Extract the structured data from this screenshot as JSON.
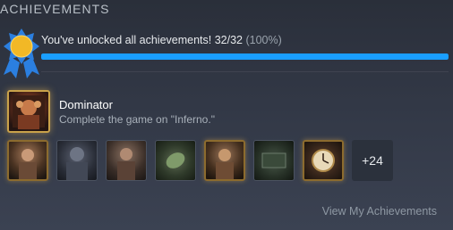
{
  "header": {
    "title": "ACHIEVEMENTS"
  },
  "summary": {
    "text": "You've unlocked all achievements! 32/32",
    "percent_text": "(100%)",
    "unlocked": 32,
    "total": 32,
    "progress_fraction": 1.0
  },
  "featured": {
    "title": "Dominator",
    "description": "Complete the game on \"Inferno.\""
  },
  "icons": [
    {
      "name": "achievement-icon-1",
      "style": "gold"
    },
    {
      "name": "achievement-icon-2",
      "style": "plain"
    },
    {
      "name": "achievement-icon-3",
      "style": "plain"
    },
    {
      "name": "achievement-icon-4",
      "style": "plain"
    },
    {
      "name": "achievement-icon-5",
      "style": "gold"
    },
    {
      "name": "achievement-icon-6",
      "style": "plain"
    },
    {
      "name": "achievement-icon-7",
      "style": "gold"
    }
  ],
  "more": {
    "label": "+24"
  },
  "footer": {
    "link_label": "View My Achievements"
  },
  "colors": {
    "accent": "#1a9fff",
    "gold": "#c9a24a",
    "badge_blue": "#2b7fe0",
    "badge_sun": "#f2b826"
  }
}
